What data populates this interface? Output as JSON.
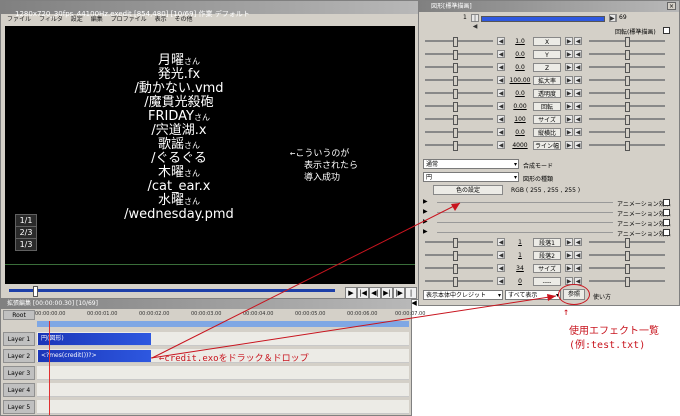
{
  "main_window": {
    "title": "1280x720_30fps_44100Hz.exedit [854,480] [10/69] 作業 デフォルト",
    "menu": [
      "ファイル",
      "フィルタ",
      "設定",
      "編集",
      "プロファイル",
      "表示",
      "その他"
    ],
    "credits": [
      {
        "text": "月曜",
        "suffix": "さん"
      },
      {
        "text": "発光.fx",
        "suffix": ""
      },
      {
        "text": "/動かない.vmd",
        "suffix": ""
      },
      {
        "text": "/魔貫光殺砲",
        "suffix": ""
      },
      {
        "text": "FRIDAY",
        "suffix": "さん"
      },
      {
        "text": "/宍道湖.x",
        "suffix": ""
      },
      {
        "text": "歌謡",
        "suffix": "さん"
      },
      {
        "text": "/ぐるぐる",
        "suffix": ""
      },
      {
        "text": "木曜",
        "suffix": "さん"
      },
      {
        "text": "/cat_ear.x",
        "suffix": ""
      },
      {
        "text": "水曜",
        "suffix": "さん"
      },
      {
        "text": "/wednesday.pmd",
        "suffix": ""
      }
    ],
    "page_buttons": [
      "1/1",
      "2/3",
      "1/3"
    ],
    "transport": [
      "▶",
      "|◀",
      "◀|",
      "▶|",
      "|▶",
      "|◀◀",
      "▶▶|"
    ]
  },
  "annotations": {
    "success": [
      "←こういうのが",
      "表示されたら",
      "導入成功"
    ],
    "drag": "←credit.exoをドラック＆ドロップ",
    "ref": [
      "↑",
      "使用エフェクト一覧",
      "(例:test.txt)"
    ]
  },
  "timeline": {
    "title": "拡張編集 [00:00:00.30] [10/69]",
    "root": "Root",
    "ruler": [
      "00:00:00.00",
      "00:00:01.00",
      "00:00:02.00",
      "00:00:03.00",
      "00:00:04.00",
      "00:00:05.00",
      "00:00:06.00",
      "00:00:07.00"
    ],
    "layers": [
      "Layer 1",
      "Layer 2",
      "Layer 3",
      "Layer 4",
      "Layer 5"
    ],
    "clips": [
      {
        "layer": 1,
        "label": "円(図形)"
      },
      {
        "layer": 2,
        "label": "<?mes(credit())?>"
      }
    ]
  },
  "dialog": {
    "title": "図形[標準描画]",
    "frame_start": "1",
    "frame_end": "69",
    "top_check_label": "回転(標準描画)",
    "params1": [
      {
        "value": "1.0",
        "label": "X"
      },
      {
        "value": "0.0",
        "label": "Y"
      },
      {
        "value": "0.0",
        "label": "Z"
      },
      {
        "value": "100.00",
        "label": "拡大率"
      },
      {
        "value": "0.0",
        "label": "透明度"
      },
      {
        "value": "0.00",
        "label": "回転"
      },
      {
        "value": "100",
        "label": "サイズ"
      },
      {
        "value": "0.0",
        "label": "縦横比"
      },
      {
        "value": "4000",
        "label": "ライン幅"
      }
    ],
    "blend_mode": "通常",
    "blend_label": "合成モード",
    "shape_type": "円",
    "shape_label": "図形の種類",
    "color_button": "色の設定",
    "rgb": "RGB ( 255 , 255 , 255 )",
    "anim_label": "アニメーション効果",
    "params2": [
      {
        "value": "1",
        "label": "段落1"
      },
      {
        "value": "1",
        "label": "段落2"
      },
      {
        "value": "34",
        "label": "サイズ"
      },
      {
        "value": "0",
        "label": "----"
      }
    ],
    "bottom_select1": "表示本体中クレジット",
    "bottom_select2": "すべて表示",
    "ref_button": "参照",
    "usage": "使い方"
  }
}
